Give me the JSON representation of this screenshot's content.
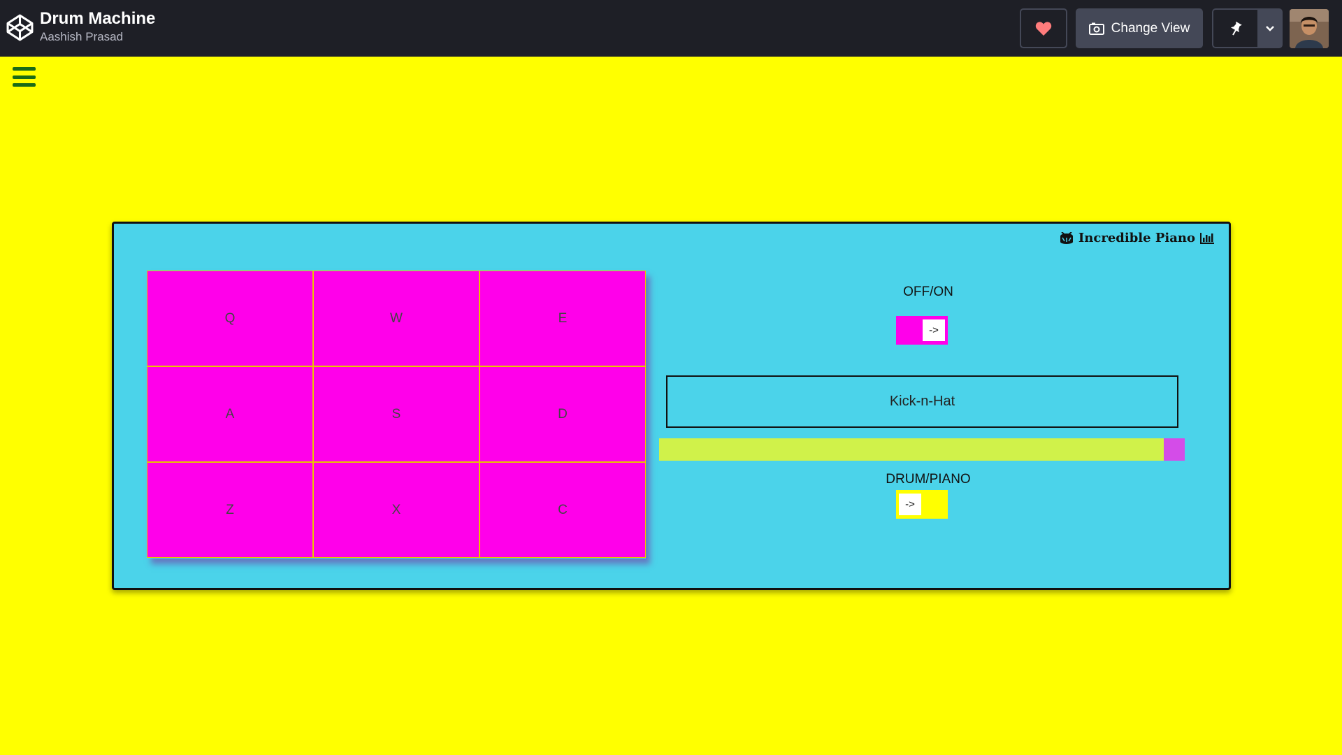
{
  "header": {
    "title": "Drum Machine",
    "author": "Aashish Prasad",
    "change_view_label": "Change View"
  },
  "machine": {
    "brand": "Incredible Piano",
    "pads": [
      "Q",
      "W",
      "E",
      "A",
      "S",
      "D",
      "Z",
      "X",
      "C"
    ],
    "power": {
      "label": "OFF/ON",
      "knob": "->",
      "state": "on",
      "color": "#ff00ea"
    },
    "display_text": "Kick-n-Hat",
    "volume": {
      "value": 1.0,
      "track_color": "#d0f24a",
      "thumb_color": "#d44ce8"
    },
    "bank": {
      "label": "DRUM/PIANO",
      "knob": "->",
      "state": "drum",
      "color": "#ffff00"
    }
  },
  "colors": {
    "page_bg": "#ffff00",
    "machine_bg": "#4bd3ea",
    "pad": "#ff00ea",
    "topbar": "#1e1f26"
  }
}
